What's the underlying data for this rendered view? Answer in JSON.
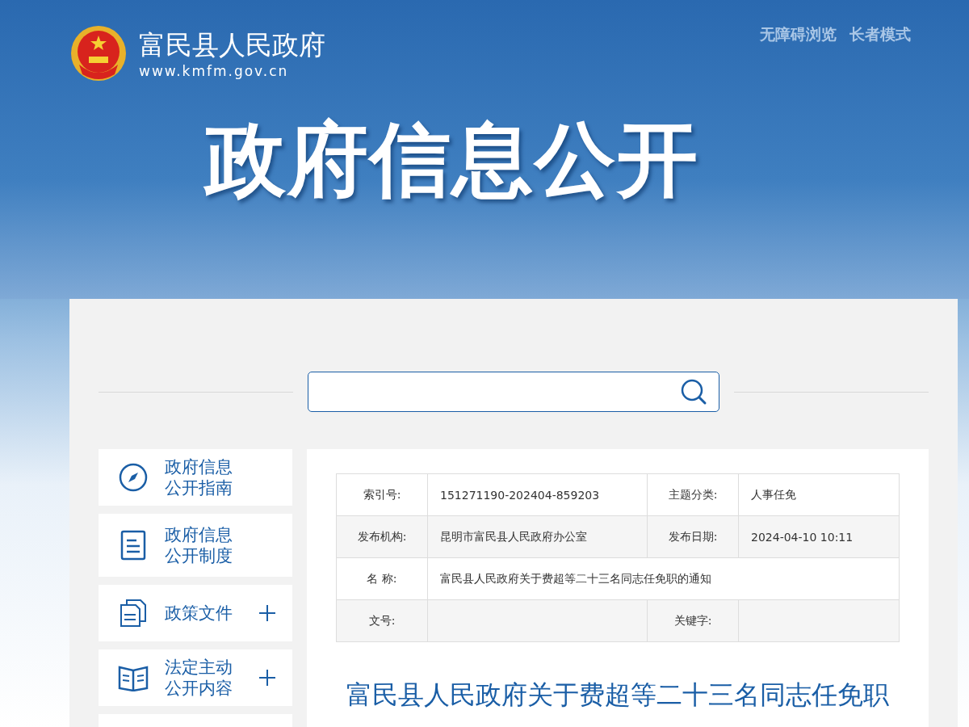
{
  "header": {
    "site_name": "富民县人民政府",
    "site_url": "www.kmfm.gov.cn",
    "links": [
      "无障碍浏览",
      "长者模式"
    ],
    "banner_title": "政府信息公开"
  },
  "sidebar": {
    "items": [
      {
        "label_lines": [
          "政府信息",
          "公开指南"
        ],
        "expandable": false
      },
      {
        "label_lines": [
          "政府信息",
          "公开制度"
        ],
        "expandable": false
      },
      {
        "label_lines": [
          "政策文件"
        ],
        "expandable": true
      },
      {
        "label_lines": [
          "法定主动",
          "公开内容"
        ],
        "expandable": true
      }
    ]
  },
  "info_table": {
    "rows": [
      [
        {
          "label": "索引号:",
          "value": "151271190-202404-859203"
        },
        {
          "label": "主题分类:",
          "value": "人事任免"
        }
      ],
      [
        {
          "label": "发布机构:",
          "value": "昆明市富民县人民政府办公室"
        },
        {
          "label": "发布日期:",
          "value": "2024-04-10 10:11"
        }
      ],
      [
        {
          "label": "名 称:",
          "value": "富民县人民政府关于费超等二十三名同志任免职的通知"
        }
      ],
      [
        {
          "label": "文号:"
        },
        {
          "label": "关键字:"
        }
      ]
    ]
  },
  "article": {
    "title": "富民县人民政府关于费超等二十三名同志任免职"
  }
}
